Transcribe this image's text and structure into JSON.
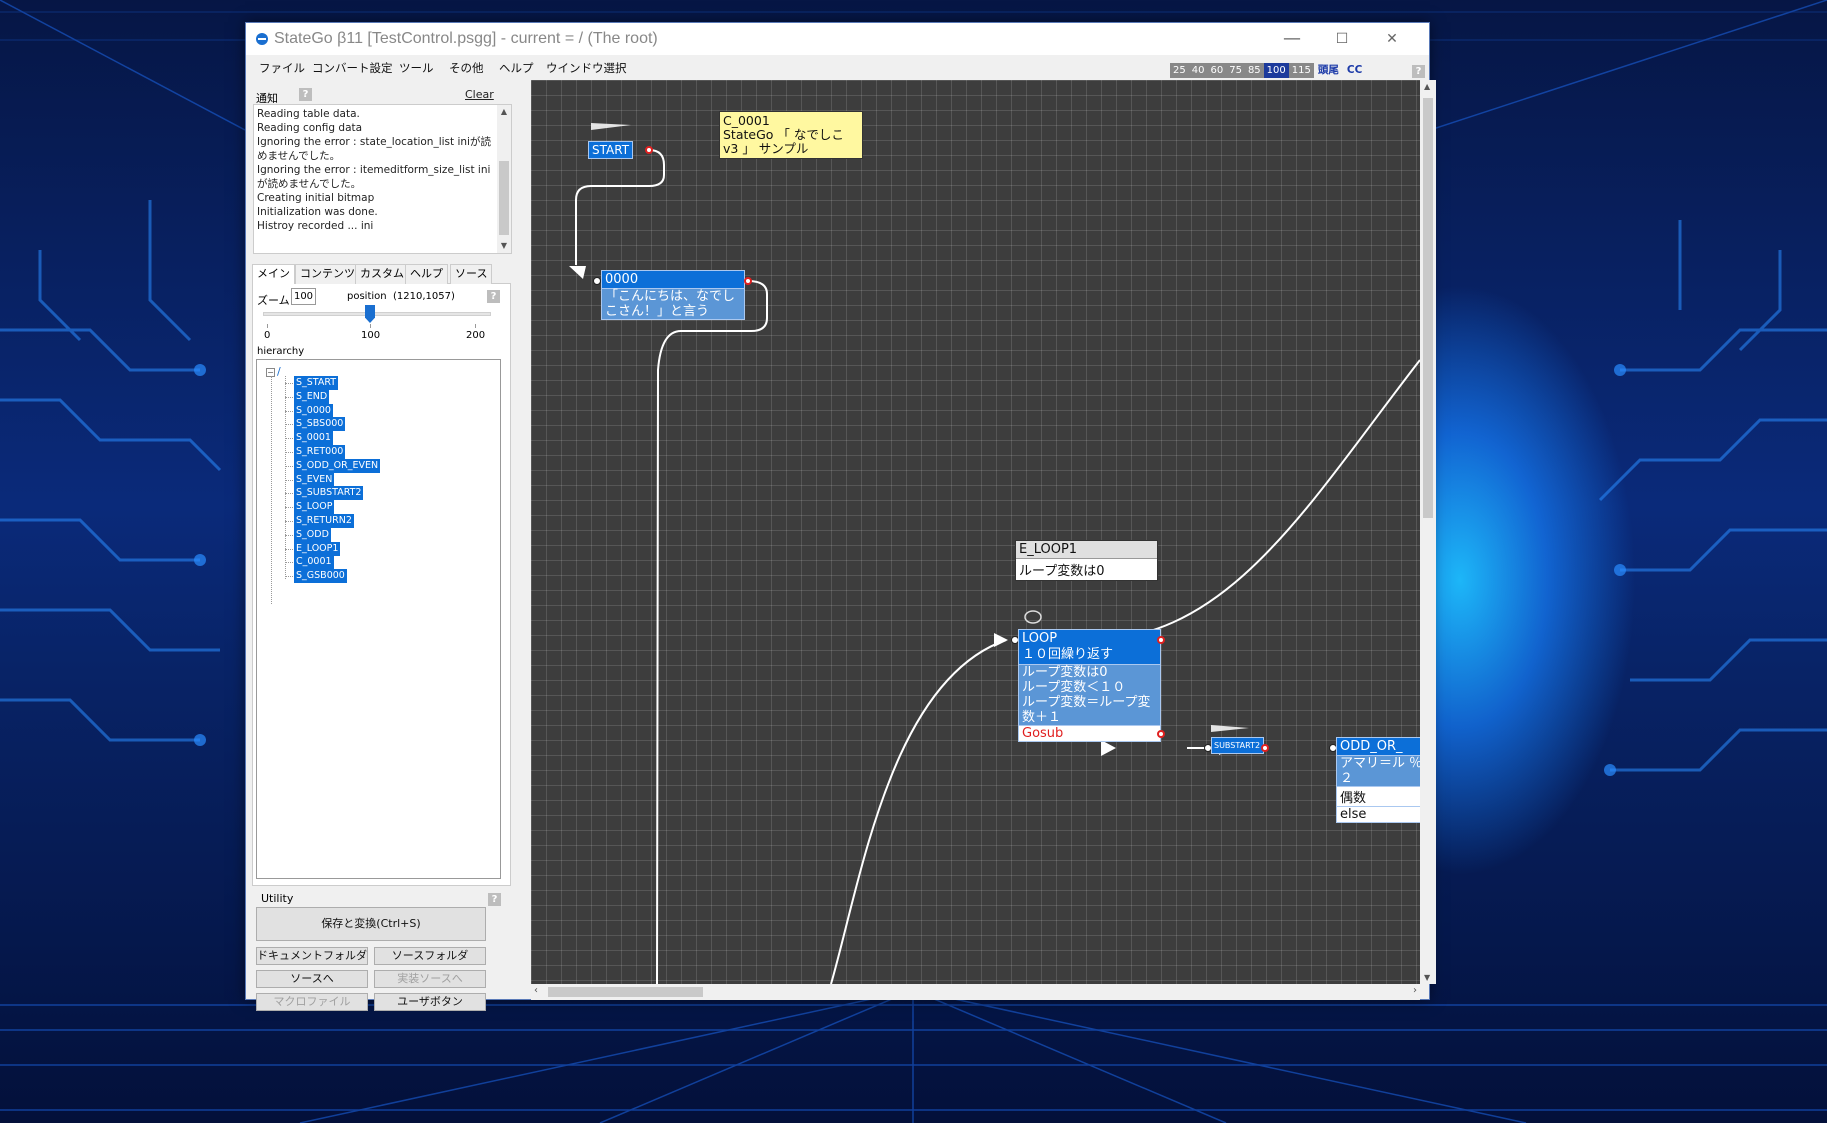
{
  "window": {
    "title": "StateGo β11   [TestControl.psgg] - current = / (The root)",
    "minimize": "—",
    "maximize": "☐",
    "close": "✕"
  },
  "menu": [
    "ファイル",
    "コンバート設定",
    "ツール",
    "その他",
    "ヘルプ",
    "ウインドウ選択"
  ],
  "zoom_bar": {
    "levels": [
      "25",
      "40",
      "60",
      "75",
      "85",
      "100",
      "115"
    ],
    "active": "100",
    "extra": [
      "頭尾",
      "CC"
    ]
  },
  "notice": {
    "label": "通知",
    "help": "?",
    "clear": "Clear",
    "log": [
      "Reading table data.",
      "Reading config data",
      "Ignoring the error : state_location_list iniが読めませんでした。",
      "Ignoring the error : itemeditform_size_list iniが読めませんでした。",
      "Creating initial bitmap",
      "Initialization was done.",
      "Histroy recorded ... ini"
    ]
  },
  "tabs": [
    "メイン",
    "コンテンツ",
    "カスタム",
    "ヘルプ",
    "ソース"
  ],
  "main_tab": {
    "zoom_label": "ズーム",
    "zoom_value": "100",
    "position_label": "position",
    "position_value": "(1210,1057)",
    "slider": {
      "min": "0",
      "mid": "100",
      "max": "200",
      "value": 100
    },
    "help": "?",
    "hierarchy_label": "hierarchy",
    "root": "/",
    "states": [
      "S_START",
      "S_END",
      "S_0000",
      "S_SBS000",
      "S_0001",
      "S_RET000",
      "S_ODD_OR_EVEN",
      "S_EVEN",
      "S_SUBSTART2",
      "S_LOOP",
      "S_RETURN2",
      "S_ODD",
      "E_LOOP1",
      "C_0001",
      "S_GSB000"
    ]
  },
  "utility": {
    "label": "Utility",
    "help": "?",
    "save_convert": "保存と変換(Ctrl+S)",
    "doc_folder": "ドキュメントフォルダ",
    "src_folder": "ソースフォルダ",
    "to_source": "ソースへ",
    "to_impl_source": "実装ソースへ",
    "macro_file": "マクロファイル",
    "user_button": "ユーザボタン"
  },
  "canvas": {
    "start_node": "START",
    "comment": {
      "title": "C_0001",
      "text": "StateGo 「 なでしこ v3 」 サンプル"
    },
    "node_0000": {
      "title": "0000",
      "body": "「こんにちは、なでしこさん！」と言う"
    },
    "e_loop": {
      "title": "E_LOOP1",
      "body": "ループ変数は0"
    },
    "loop_node": {
      "title": "LOOP",
      "subtitle": "１０回繰り返す",
      "body": [
        "ループ変数は0",
        "ループ変数＜１０",
        "ループ変数＝ループ変数＋１"
      ],
      "gosub": "Gosub"
    },
    "substart": "SUBSTART2",
    "odd_or_even": {
      "title": "ODD_OR_",
      "body": "アマリ＝ル ％ ２",
      "row1": "偶数",
      "row2": "else"
    }
  },
  "colors": {
    "accent": "#0c6fd8",
    "canvas_bg": "#3d3d3d",
    "comment_bg": "#fff8a0",
    "gosub_text": "#e02020"
  }
}
